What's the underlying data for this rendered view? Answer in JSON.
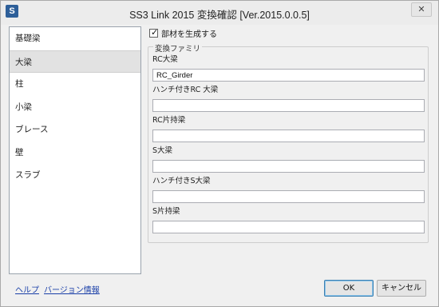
{
  "titlebar": {
    "title": "SS3 Link 2015 変換確認 [Ver.2015.0.0.5]",
    "app_icon_letter": "S",
    "close_symbol": "✕"
  },
  "sidebar": {
    "items": [
      {
        "label": "基礎梁"
      },
      {
        "label": "大梁"
      },
      {
        "label": "柱"
      },
      {
        "label": "小梁"
      },
      {
        "label": "ブレース"
      },
      {
        "label": "壁"
      },
      {
        "label": "スラブ"
      }
    ],
    "selected_index": 1
  },
  "options": {
    "generate_member_label": "部材を生成する",
    "generate_member_checked": true
  },
  "family_group": {
    "legend": "変換ファミリ",
    "fields": [
      {
        "label": "RC大梁",
        "value": "RC_Girder"
      },
      {
        "label": "ハンチ付きRC 大梁",
        "value": ""
      },
      {
        "label": "RC片持梁",
        "value": ""
      },
      {
        "label": "S大梁",
        "value": ""
      },
      {
        "label": "ハンチ付きS大梁",
        "value": ""
      },
      {
        "label": "S片持梁",
        "value": ""
      }
    ]
  },
  "footer": {
    "help_link": "ヘルプ",
    "version_link": "バージョン情報",
    "ok_label": "OK",
    "cancel_label": "キャンセル"
  },
  "colors": {
    "app_icon": "#2e5f99",
    "link": "#1a3fa8",
    "selection": "#e2e2e2"
  }
}
